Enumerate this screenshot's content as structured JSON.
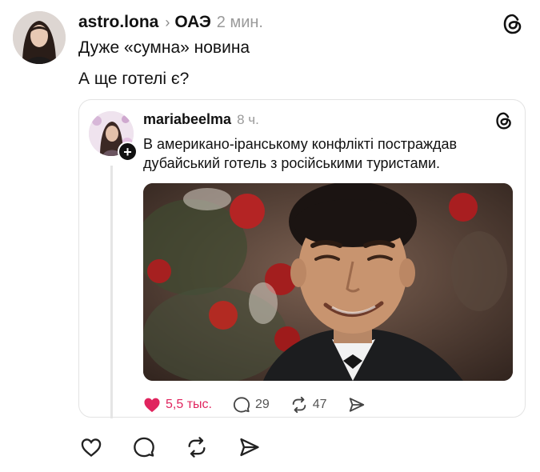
{
  "author": {
    "username": "astro.lona",
    "chevron": "›",
    "location": "ОАЭ",
    "time_ago": "2 мин."
  },
  "post": {
    "line1": "Дуже «сумна» новина",
    "line2": "А ще готелі є?"
  },
  "quoted_post": {
    "username": "mariabeelma",
    "time_ago": "8 ч.",
    "text": "В американо-іранському конфлікті постраждав дубайський готель з російськими туристами.",
    "follow_badge": "+",
    "likes": "5,5 тыс.",
    "comments": "29",
    "reposts": "47"
  },
  "colors": {
    "like_red": "#e0245e",
    "text_primary": "#111111",
    "text_secondary": "#9a9a9a",
    "card_border": "#e3e3e3"
  },
  "icons": {
    "threads_logo": "threads-logo-icon",
    "heart_filled": "heart-filled-icon",
    "comment": "comment-icon",
    "repost": "repost-icon",
    "share": "share-icon",
    "heart_outline": "heart-icon"
  }
}
